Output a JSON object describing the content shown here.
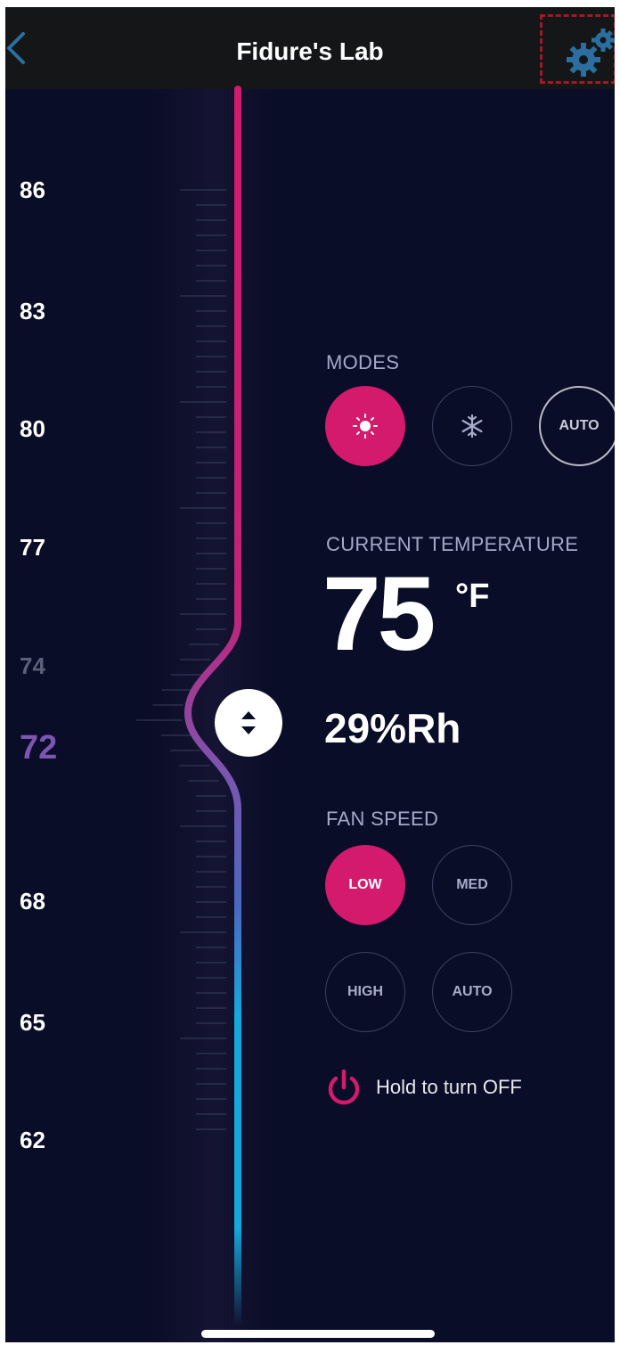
{
  "header": {
    "title": "Fidure's Lab",
    "back_icon": "chevron-left-icon",
    "settings_icon": "gears-icon"
  },
  "scale": {
    "labels": [
      "86",
      "83",
      "80",
      "77",
      "74",
      "72",
      "68",
      "65",
      "62"
    ],
    "current": "72"
  },
  "modes": {
    "label": "MODES",
    "options": [
      {
        "icon": "sun-icon",
        "active": true
      },
      {
        "icon": "snowflake-icon",
        "active": false
      },
      {
        "label": "AUTO",
        "active": false
      }
    ]
  },
  "current_temperature": {
    "label": "CURRENT TEMPERATURE",
    "value": "75",
    "unit": "°F",
    "humidity": "29%Rh"
  },
  "fan_speed": {
    "label": "FAN SPEED",
    "options": [
      "LOW",
      "MED",
      "HIGH",
      "AUTO"
    ],
    "selected": "LOW"
  },
  "power": {
    "icon": "power-icon",
    "label": "Hold to turn OFF"
  },
  "colors": {
    "background": "#0a0d27",
    "header": "#151617",
    "accent": "#d31a6d",
    "cool": "#15a8df",
    "current_label": "#7c55b0",
    "icon_blue": "#2a6fa0"
  }
}
